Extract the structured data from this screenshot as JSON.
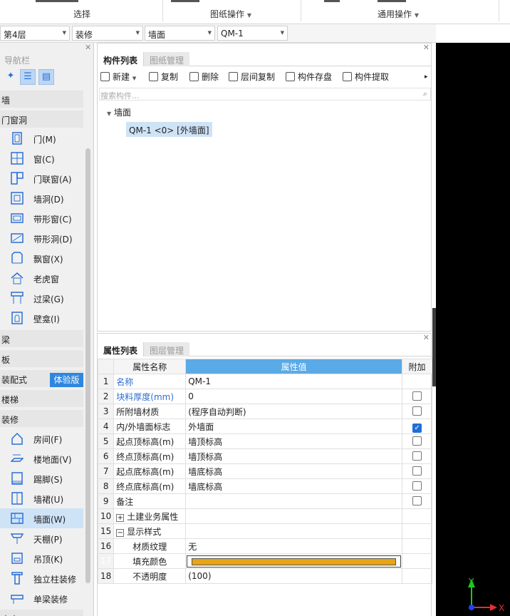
{
  "ribbon": {
    "groups": [
      "选择",
      "图纸操作",
      "通用操作"
    ]
  },
  "selectors": [
    {
      "value": "第4层"
    },
    {
      "value": "装修"
    },
    {
      "value": "墙面"
    },
    {
      "value": "QM-1"
    }
  ],
  "nav": {
    "title": "导航栏",
    "categories": {
      "wall": "墙",
      "openings": "门窗洞",
      "beam": "梁",
      "slab": "板",
      "prefab": "装配式",
      "stairs": "楼梯",
      "decoration": "装修",
      "more": "土方"
    },
    "trial_badge": "体验版",
    "opening_items": [
      "门(M)",
      "窗(C)",
      "门联窗(A)",
      "墙洞(D)",
      "带形窗(C)",
      "带形洞(D)",
      "飘窗(X)",
      "老虎窗",
      "过梁(G)",
      "壁龛(I)"
    ],
    "decoration_items": [
      "房间(F)",
      "楼地面(V)",
      "踢脚(S)",
      "墙裙(U)",
      "墙面(W)",
      "天棚(P)",
      "吊顶(K)",
      "独立柱装修",
      "单梁装修"
    ]
  },
  "component_panel": {
    "tabs": [
      "构件列表",
      "图纸管理"
    ],
    "toolbar": [
      "新建",
      "复制",
      "删除",
      "层间复制",
      "构件存盘",
      "构件提取"
    ],
    "search_placeholder": "搜索构件...",
    "tree_root": "墙面",
    "tree_item": "QM-1 <0> [外墙面]"
  },
  "property_panel": {
    "tabs": [
      "属性列表",
      "图层管理"
    ],
    "headers": {
      "name": "属性名称",
      "value": "属性值",
      "extra": "附加"
    },
    "rows": [
      {
        "num": "1",
        "name": "名称",
        "value": "QM-1"
      },
      {
        "num": "2",
        "name": "块料厚度(mm)",
        "value": "0"
      },
      {
        "num": "3",
        "name": "所附墙材质",
        "value": "(程序自动判断)"
      },
      {
        "num": "4",
        "name": "内/外墙面标志",
        "value": "外墙面"
      },
      {
        "num": "5",
        "name": "起点顶标高(m)",
        "value": "墙顶标高"
      },
      {
        "num": "6",
        "name": "终点顶标高(m)",
        "value": "墙顶标高"
      },
      {
        "num": "7",
        "name": "起点底标高(m)",
        "value": "墙底标高"
      },
      {
        "num": "8",
        "name": "终点底标高(m)",
        "value": "墙底标高"
      },
      {
        "num": "9",
        "name": "备注",
        "value": ""
      },
      {
        "num": "10",
        "name": "土建业务属性",
        "value": ""
      },
      {
        "num": "15",
        "name": "显示样式",
        "value": ""
      },
      {
        "num": "16",
        "name": "材质纹理",
        "value": "无"
      },
      {
        "num": "17",
        "name": "填充颜色",
        "value": ""
      },
      {
        "num": "18",
        "name": "不透明度",
        "value": "(100)"
      }
    ],
    "fill_color": "#e8a414"
  },
  "axes": {
    "y": "Y",
    "x": "X"
  }
}
